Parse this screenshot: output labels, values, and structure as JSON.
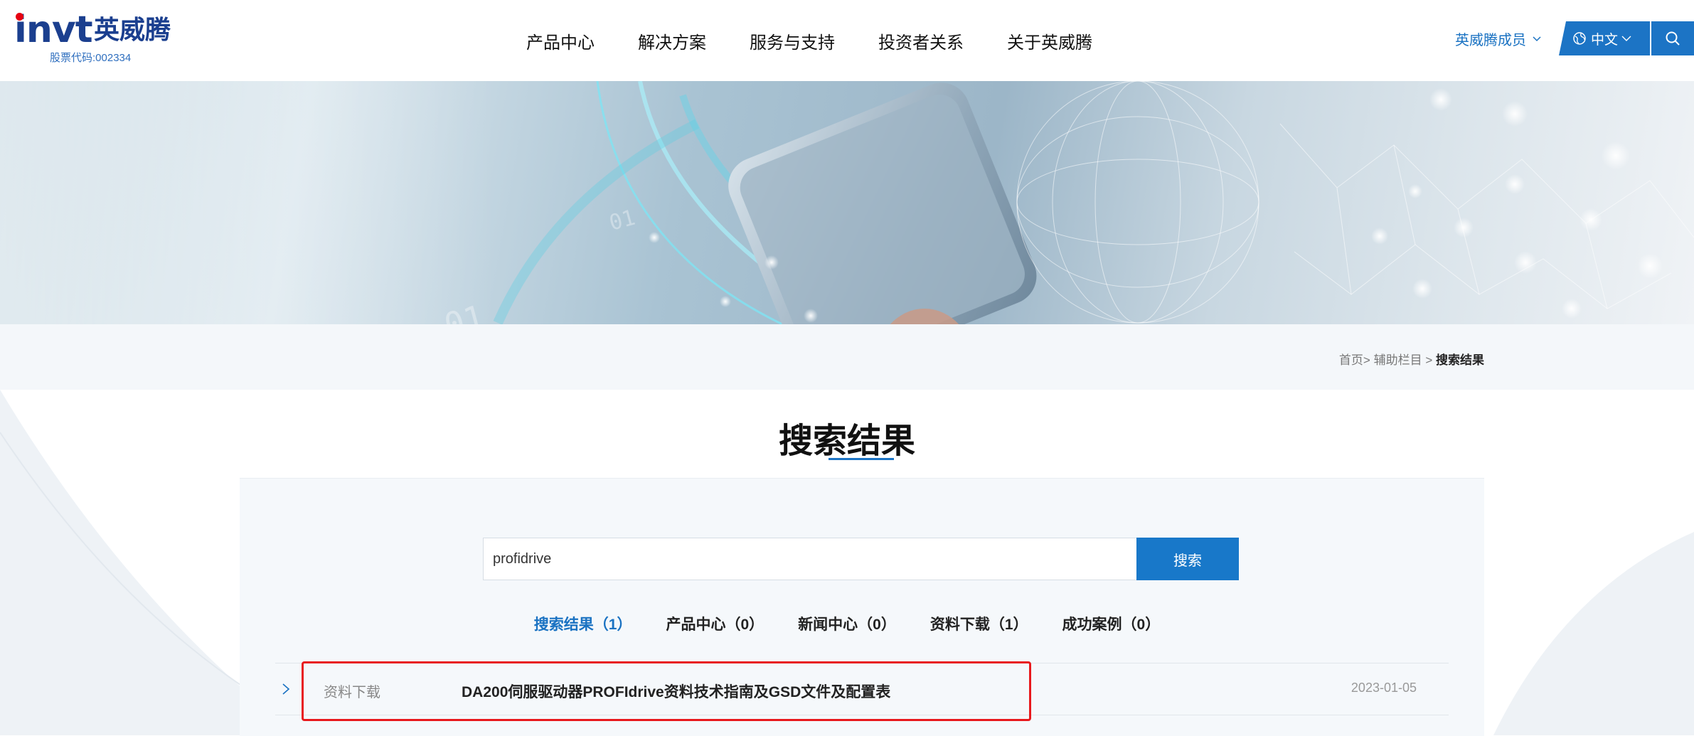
{
  "header": {
    "logo_text": "invt",
    "logo_cn": "英威腾",
    "stock_code": "股票代码:002334",
    "nav": [
      "产品中心",
      "解决方案",
      "服务与支持",
      "投资者关系",
      "关于英威腾"
    ],
    "member_label": "英威腾成员",
    "lang_label": "中文",
    "icons": [
      "globe-icon",
      "chevron-down-icon",
      "search-icon"
    ]
  },
  "breadcrumb": {
    "home": "首页>",
    "section": "辅助栏目",
    "sep": ">",
    "current": "搜索结果"
  },
  "page_title": "搜索结果",
  "search": {
    "value": "profidrive",
    "button_label": "搜索"
  },
  "tabs": [
    {
      "label": "搜索结果（1）"
    },
    {
      "label": "产品中心（0）"
    },
    {
      "label": "新闻中心（0）"
    },
    {
      "label": "资料下载（1）"
    },
    {
      "label": "成功案例（0）"
    }
  ],
  "results": [
    {
      "category": "资料下载",
      "title": "DA200伺服驱动器PROFIdrive资料技术指南及GSD文件及配置表",
      "date": "2023-01-05"
    }
  ],
  "colors": {
    "accent": "#1c74c5",
    "brand_navy": "#1b3f8f",
    "logo_red": "#e60012",
    "highlight": "#e8191d"
  }
}
